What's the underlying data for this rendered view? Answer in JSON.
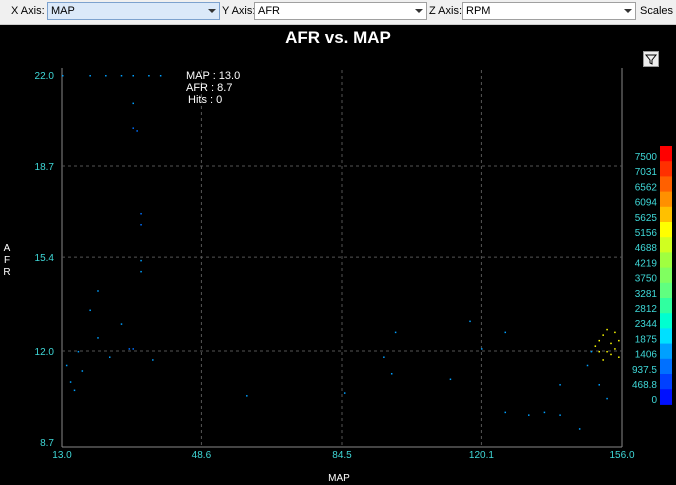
{
  "toolbar": {
    "x_label": "X Axis:",
    "x_value": "MAP",
    "y_label": "Y Axis:",
    "y_value": "AFR",
    "z_label": "Z Axis:",
    "z_value": "RPM",
    "scales": "Scales"
  },
  "readout": {
    "map": "MAP : 13.0",
    "afr": "AFR : 8.7",
    "hits": "Hits : 0"
  },
  "chart_data": {
    "type": "scatter",
    "title": "AFR vs. MAP",
    "xlabel": "MAP",
    "ylabel": "AFR",
    "xlim": [
      13.0,
      156.0
    ],
    "ylim": [
      8.7,
      22.0
    ],
    "xticks": [
      "13.0",
      "48.6",
      "84.5",
      "120.1",
      "156.0"
    ],
    "yticks": [
      "22.0",
      "18.7",
      "15.4",
      "12.0",
      "8.7"
    ],
    "colorbar": {
      "label": "RPM",
      "ticks": [
        "7500",
        "7031",
        "6562",
        "6094",
        "5625",
        "5156",
        "4688",
        "4219",
        "3750",
        "3281",
        "2812",
        "2344",
        "1875",
        "1406",
        "937.5",
        "468.8",
        "0"
      ],
      "colors": [
        "#ff0000",
        "#ff3000",
        "#ff6000",
        "#ff9000",
        "#ffc000",
        "#ffff00",
        "#d0ff20",
        "#a0ff40",
        "#80ff60",
        "#60ff80",
        "#30ffa0",
        "#00ffd0",
        "#00e0ff",
        "#00a0ff",
        "#0070ff",
        "#0040ff",
        "#0010ff"
      ]
    },
    "points": [
      [
        13,
        22,
        1406
      ],
      [
        20,
        22,
        1406
      ],
      [
        24,
        22,
        1406
      ],
      [
        28,
        22,
        1406
      ],
      [
        31,
        22,
        1406
      ],
      [
        35,
        22,
        1406
      ],
      [
        38,
        22,
        1406
      ],
      [
        31,
        21,
        1406
      ],
      [
        31,
        20.1,
        900
      ],
      [
        32,
        20,
        900
      ],
      [
        33,
        17,
        900
      ],
      [
        33,
        16.6,
        900
      ],
      [
        33,
        15.3,
        1406
      ],
      [
        33,
        14.9,
        1406
      ],
      [
        22,
        14.2,
        1406
      ],
      [
        20,
        13.5,
        1406
      ],
      [
        28,
        13,
        1406
      ],
      [
        22,
        12.5,
        1406
      ],
      [
        30,
        12.1,
        900
      ],
      [
        31,
        12.1,
        900
      ],
      [
        17,
        12,
        1406
      ],
      [
        25,
        11.8,
        1406
      ],
      [
        36,
        11.7,
        1406
      ],
      [
        14,
        11.5,
        1406
      ],
      [
        18,
        11.3,
        1406
      ],
      [
        15,
        10.9,
        1406
      ],
      [
        16,
        10.6,
        1406
      ],
      [
        60,
        10.4,
        1406
      ],
      [
        85,
        10.5,
        1406
      ],
      [
        95,
        11.8,
        1406
      ],
      [
        97,
        11.2,
        1406
      ],
      [
        98,
        12.7,
        1406
      ],
      [
        112,
        11.0,
        1406
      ],
      [
        120,
        12.1,
        1406
      ],
      [
        117,
        13.1,
        1406
      ],
      [
        126,
        12.7,
        1406
      ],
      [
        126,
        9.8,
        1406
      ],
      [
        132,
        9.7,
        1406
      ],
      [
        136,
        9.8,
        1406
      ],
      [
        140,
        10.8,
        1406
      ],
      [
        140,
        9.7,
        1406
      ],
      [
        145,
        9.2,
        1406
      ],
      [
        150,
        10.8,
        1406
      ],
      [
        152,
        10.3,
        1406
      ],
      [
        147,
        11.5,
        1406
      ],
      [
        148,
        12,
        1406
      ],
      [
        149,
        12.2,
        5156
      ],
      [
        150,
        12.4,
        5156
      ],
      [
        151,
        12.6,
        5156
      ],
      [
        152,
        12.8,
        5156
      ],
      [
        153,
        12.3,
        5156
      ],
      [
        154,
        12.1,
        5156
      ],
      [
        155,
        12.4,
        5156
      ],
      [
        153,
        11.9,
        5156
      ],
      [
        151,
        11.7,
        5156
      ],
      [
        155,
        11.8,
        5156
      ],
      [
        152,
        12.0,
        5156
      ],
      [
        154,
        12.7,
        5156
      ],
      [
        150,
        12.0,
        5156
      ]
    ]
  }
}
